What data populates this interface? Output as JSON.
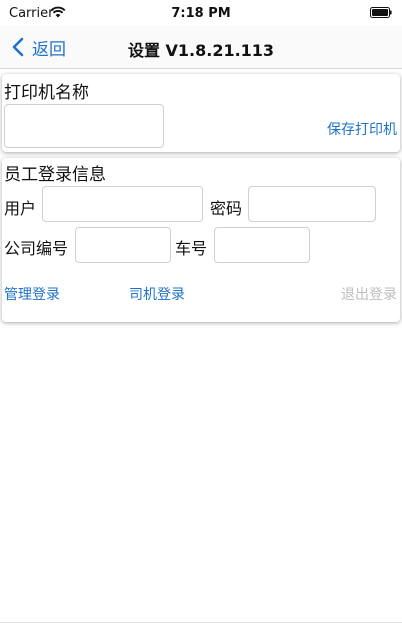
{
  "status_bar": {
    "carrier": "Carrier",
    "time": "7:18 PM",
    "icons": [
      "wifi-icon",
      "battery-icon"
    ]
  },
  "nav": {
    "back_label": "返回",
    "title": "设置 V1.8.21.113",
    "accent_color": "#1f73c6"
  },
  "printer_section": {
    "title": "打印机名称",
    "printer_name_value": "",
    "save_label": "保存打印机"
  },
  "login_section": {
    "title": "员工登录信息",
    "user_label": "用户",
    "user_value": "",
    "password_label": "密码",
    "password_value": "",
    "company_label": "公司编号",
    "company_value": "",
    "car_label": "车号",
    "car_value": "",
    "admin_login_label": "管理登录",
    "driver_login_label": "司机登录",
    "logout_label": "退出登录",
    "logout_color": "#bdbdbd"
  }
}
